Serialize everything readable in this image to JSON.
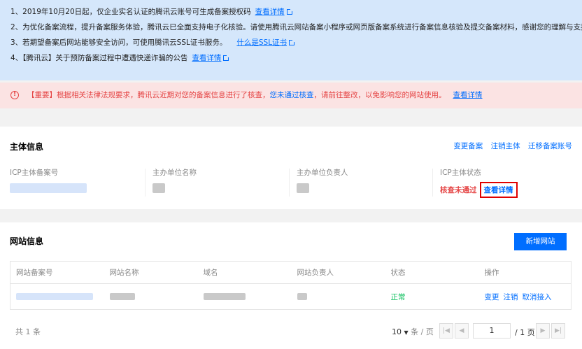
{
  "notice": {
    "line1_text": "1、2019年10月20日起，仅企业实名认证的腾讯云账号可生成备案授权码",
    "line1_link": "查看详情",
    "line2_text": "2、为优化备案流程，提升备案服务体验，腾讯云已全面支持电子化核验。请使用腾讯云网站备案小程序或网页版备案系统进行备案信息核验及提交备案材料，感谢您的理解与支持。",
    "line3_text": "3、若期望备案后网站能够安全访问，可使用腾讯云SSL证书服务。",
    "line3_link": "什么是SSL证书",
    "line4_text": "4、【腾讯云】关于预防备案过程中遭遇快递诈骗的公告",
    "line4_link": "查看详情"
  },
  "alert": {
    "text_before": "【重要】根据相关法律法规要求，腾讯云近期对您的备案信息进行了核查，",
    "highlight": "您未通过核查",
    "text_after": "，请前往整改，以免影响您的网站使用。",
    "link": "查看详情"
  },
  "subject": {
    "title": "主体信息",
    "actions": [
      "变更备案",
      "注销主体",
      "迁移备案账号"
    ],
    "fields": {
      "icp_no_label": "ICP主体备案号",
      "org_name_label": "主办单位名称",
      "org_owner_label": "主办单位负责人",
      "icp_status_label": "ICP主体状态"
    },
    "status_text": "核查未通过",
    "detail_link": "查看详情"
  },
  "website": {
    "title": "网站信息",
    "add_button": "新增网站",
    "columns": [
      "网站备案号",
      "网站名称",
      "域名",
      "网站负责人",
      "状态",
      "操作"
    ],
    "row_status": "正常",
    "row_ops": [
      "变更",
      "注销",
      "取消接入"
    ]
  },
  "pager": {
    "total": "共 1 条",
    "page_size": "10",
    "page_size_unit": "条 / 页",
    "current_page": "1",
    "total_pages": "/ 1 页"
  }
}
